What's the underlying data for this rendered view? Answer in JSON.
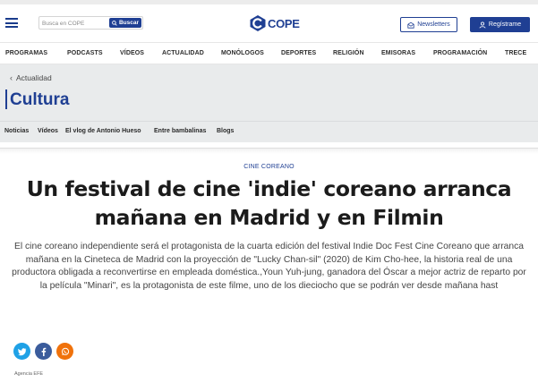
{
  "header": {
    "search_placeholder": "Busca en COPE",
    "search_button": "Buscar",
    "logo_text": "COPE",
    "newsletters_label": "Newsletters",
    "register_label": "Regístrame"
  },
  "nav": {
    "items": [
      "PROGRAMAS",
      "PODCASTS",
      "VÍDEOS",
      "ACTUALIDAD",
      "MONÓLOGOS",
      "DEPORTES",
      "RELIGIÓN",
      "EMISORAS",
      "PROGRAMACIÓN",
      "TRECE"
    ]
  },
  "section": {
    "back_label": "Actualidad",
    "title": "Cultura"
  },
  "subnav": {
    "items": [
      "Noticias",
      "Vídeos",
      "El vlog de Antonio Hueso",
      "Entre bambalinas",
      "Blogs"
    ]
  },
  "article": {
    "kicker": "CINE COREANO",
    "headline": "Un festival de cine 'indie' coreano arranca mañana en Madrid y en Filmin",
    "lead": "El cine coreano independiente será el protagonista de la cuarta edición del festival Indie Doc Fest Cine Coreano que arranca mañana en la Cineteca de Madrid con la proyección de \"Lucky Chan-sil\" (2020) de Kim Cho-hee, la historia real de una productora obligada a reconvertirse en empleada doméstica.,Youn Yuh-jung, ganadora del Óscar a mejor actriz de reparto por la película \"Minari\", es la protagonista de este filme, uno de los dieciocho que se podrán ver desde mañana hast",
    "agency": "Agencia EFE"
  },
  "share": {
    "icons": [
      "twitter-icon",
      "facebook-icon",
      "whatsapp-icon"
    ]
  },
  "colors": {
    "brand": "#1f3f93",
    "twitter": "#1fa1e6",
    "facebook": "#3b5c9c",
    "whatsapp": "#f0720b",
    "section_bg": "#e9ebec"
  }
}
